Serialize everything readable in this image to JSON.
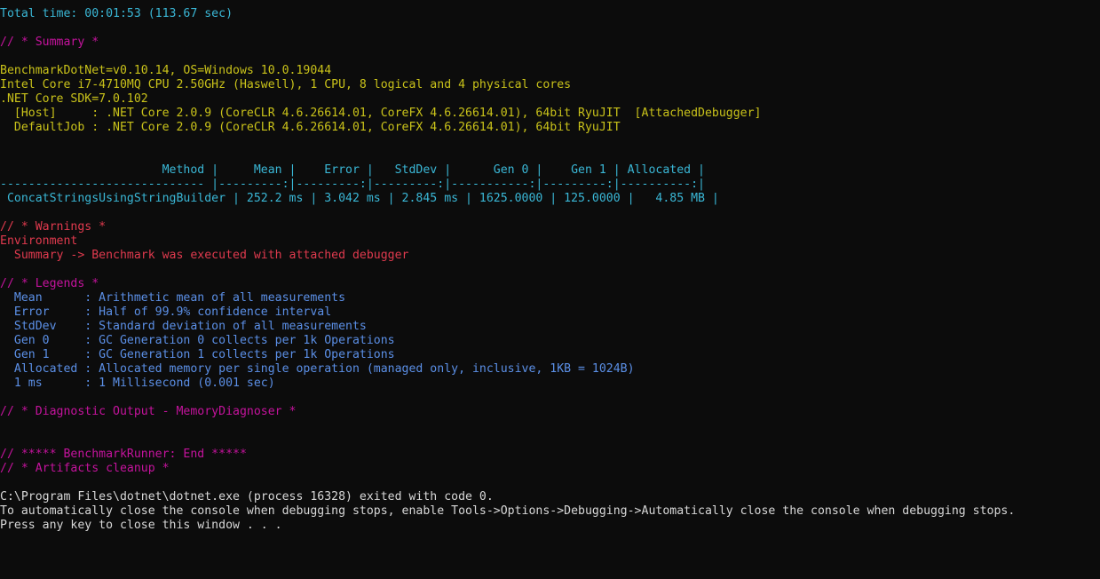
{
  "colors": {
    "background": "#0c0c0c",
    "cyan": "#3ab7d6",
    "magenta": "#c5139d",
    "yellow": "#c9c21a",
    "red": "#e03a4e",
    "blue": "#5b8fe6",
    "white": "#d8d8d8"
  },
  "console": {
    "lines": [
      {
        "text": "Total time: 00:01:53 (113.67 sec)",
        "color": "cyan"
      },
      {
        "text": "",
        "color": "white"
      },
      {
        "text": "// * Summary *",
        "color": "magenta"
      },
      {
        "text": "",
        "color": "white"
      },
      {
        "text": "BenchmarkDotNet=v0.10.14, OS=Windows 10.0.19044",
        "color": "yellow"
      },
      {
        "text": "Intel Core i7-4710MQ CPU 2.50GHz (Haswell), 1 CPU, 8 logical and 4 physical cores",
        "color": "yellow"
      },
      {
        "text": ".NET Core SDK=7.0.102",
        "color": "yellow"
      },
      {
        "text": "  [Host]     : .NET Core 2.0.9 (CoreCLR 4.6.26614.01, CoreFX 4.6.26614.01), 64bit RyuJIT  [AttachedDebugger]",
        "color": "yellow"
      },
      {
        "text": "  DefaultJob : .NET Core 2.0.9 (CoreCLR 4.6.26614.01, CoreFX 4.6.26614.01), 64bit RyuJIT",
        "color": "yellow"
      },
      {
        "text": "",
        "color": "white"
      },
      {
        "text": "",
        "color": "white"
      },
      {
        "text": "                       Method |     Mean |    Error |   StdDev |      Gen 0 |    Gen 1 | Allocated |",
        "color": "cyan"
      },
      {
        "text": "----------------------------- |---------:|---------:|---------:|-----------:|---------:|----------:|",
        "color": "cyan"
      },
      {
        "text": " ConcatStringsUsingStringBuilder | 252.2 ms | 3.042 ms | 2.845 ms | 1625.0000 | 125.0000 |   4.85 MB |",
        "color": "cyan"
      },
      {
        "text": "",
        "color": "white"
      },
      {
        "text": "// * Warnings *",
        "color": "red"
      },
      {
        "text": "Environment",
        "color": "red"
      },
      {
        "text": "  Summary -> Benchmark was executed with attached debugger",
        "color": "red"
      },
      {
        "text": "",
        "color": "white"
      },
      {
        "text": "// * Legends *",
        "color": "magenta"
      },
      {
        "text": "  Mean      : Arithmetic mean of all measurements",
        "color": "blue"
      },
      {
        "text": "  Error     : Half of 99.9% confidence interval",
        "color": "blue"
      },
      {
        "text": "  StdDev    : Standard deviation of all measurements",
        "color": "blue"
      },
      {
        "text": "  Gen 0     : GC Generation 0 collects per 1k Operations",
        "color": "blue"
      },
      {
        "text": "  Gen 1     : GC Generation 1 collects per 1k Operations",
        "color": "blue"
      },
      {
        "text": "  Allocated : Allocated memory per single operation (managed only, inclusive, 1KB = 1024B)",
        "color": "blue"
      },
      {
        "text": "  1 ms      : 1 Millisecond (0.001 sec)",
        "color": "blue"
      },
      {
        "text": "",
        "color": "white"
      },
      {
        "text": "// * Diagnostic Output - MemoryDiagnoser *",
        "color": "magenta"
      },
      {
        "text": "",
        "color": "white"
      },
      {
        "text": "",
        "color": "white"
      },
      {
        "text": "// ***** BenchmarkRunner: End *****",
        "color": "magenta"
      },
      {
        "text": "// * Artifacts cleanup *",
        "color": "magenta"
      },
      {
        "text": "",
        "color": "white"
      },
      {
        "text": "C:\\Program Files\\dotnet\\dotnet.exe (process 16328) exited with code 0.",
        "color": "white"
      },
      {
        "text": "To automatically close the console when debugging stops, enable Tools->Options->Debugging->Automatically close the console when debugging stops.",
        "color": "white"
      },
      {
        "text": "Press any key to close this window . . .",
        "color": "white"
      }
    ]
  }
}
